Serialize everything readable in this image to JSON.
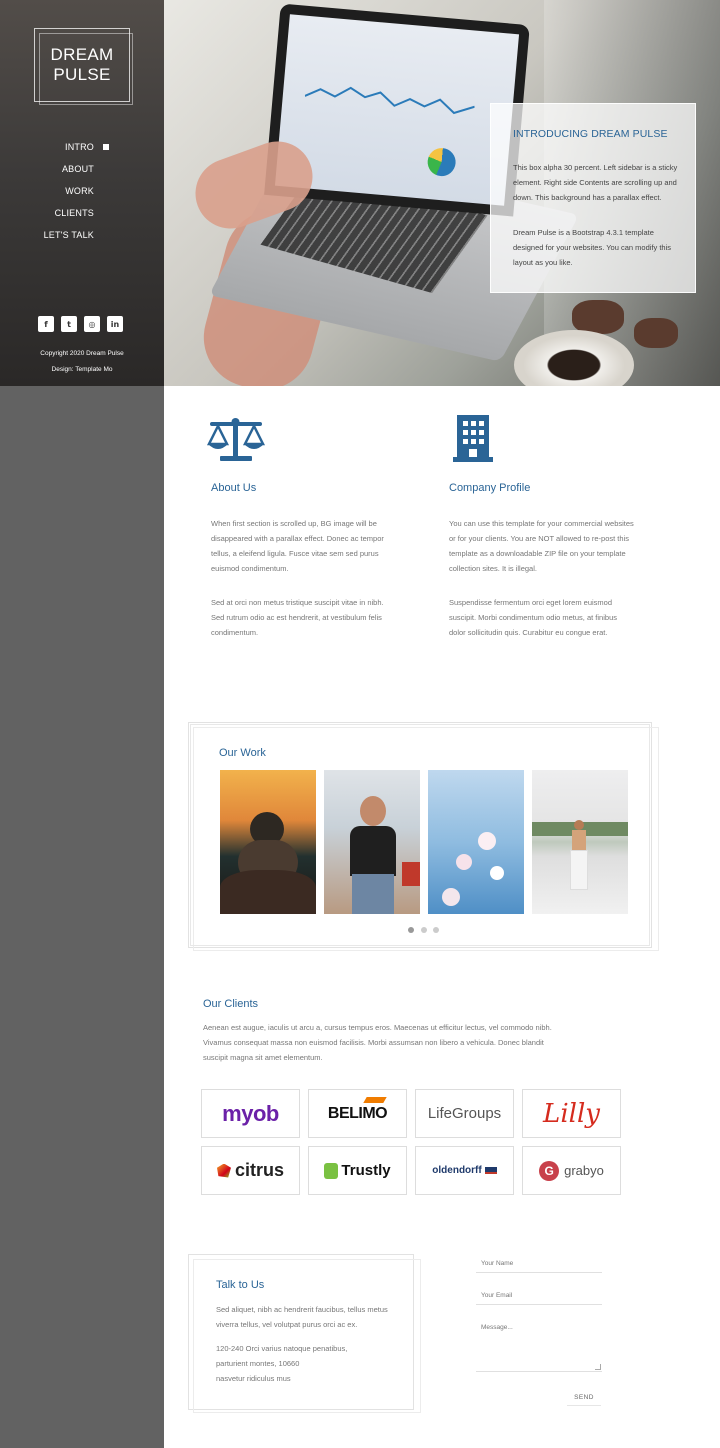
{
  "brand": {
    "line1": "DREAM",
    "line2": "PULSE"
  },
  "nav": {
    "items": [
      {
        "label": "INTRO",
        "active": true
      },
      {
        "label": "ABOUT",
        "active": false
      },
      {
        "label": "WORK",
        "active": false
      },
      {
        "label": "CLIENTS",
        "active": false
      },
      {
        "label": "LET'S TALK",
        "active": false
      }
    ]
  },
  "social": [
    {
      "icon": "facebook-icon",
      "glyph": "f"
    },
    {
      "icon": "twitter-icon",
      "glyph": "t"
    },
    {
      "icon": "dribbble-icon",
      "glyph": "◎"
    },
    {
      "icon": "linkedin-icon",
      "glyph": "in"
    }
  ],
  "footer": {
    "copyright": "Copyright 2020 Dream Pulse",
    "design": "Design: Template Mo"
  },
  "intro": {
    "title": "INTRODUCING DREAM PULSE",
    "p1": "This box alpha 30 percent. Left sidebar is a sticky element. Right side Contents are scrolling up and down. This background has a parallax effect.",
    "p2": "Dream Pulse is a Bootstrap 4.3.1 template designed for your websites. You can modify this layout as you like."
  },
  "about": {
    "title": "About Us",
    "icon": "balance-scale-icon",
    "p1": "When first section is scrolled up, BG image will be disappeared with a parallax effect. Donec ac tempor tellus, a eleifend ligula. Fusce vitae sem sed purus euismod condimentum.",
    "p2": "Sed at orci non metus tristique suscipit vitae in nibh. Sed rutrum odio ac est hendrerit, at vestibulum felis condimentum."
  },
  "company": {
    "title": "Company Profile",
    "icon": "building-icon",
    "p1": "You can use this template for your commercial websites or for your clients. You are NOT allowed to re-post this template as a downloadable ZIP file on your template collection sites. It is illegal.",
    "p2": "Suspendisse fermentum orci eget lorem euismod suscipit. Morbi condimentum odio metus, at finibus dolor sollicitudin quis. Curabitur eu congue erat."
  },
  "work": {
    "title": "Our Work",
    "photos": [
      "dog-photo",
      "woman-sunglasses-photo",
      "flowers-photo",
      "woman-rooftop-photo"
    ],
    "pages": 3,
    "active_page": 1
  },
  "clients": {
    "title": "Our Clients",
    "text": "Aenean est augue, iaculis ut arcu a, cursus tempus eros. Maecenas ut efficitur lectus, vel commodo nibh. Vivamus consequat massa non euismod facilisis. Morbi assumsan non libero a vehicula. Donec blandit suscipit magna sit amet elementum.",
    "logos": [
      {
        "name": "myob",
        "color": "#6b21a8"
      },
      {
        "name": "BELIMO",
        "color": "#111111"
      },
      {
        "name": "LifeGroups",
        "color": "#555555"
      },
      {
        "name": "Lilly",
        "color": "#d52b1e"
      },
      {
        "name": "citrus",
        "color": "#222222"
      },
      {
        "name": "Trustly",
        "color": "#111111"
      },
      {
        "name": "oldendorff",
        "color": "#1f3a6b"
      },
      {
        "name": "grabyo",
        "color": "#555555"
      }
    ]
  },
  "contact": {
    "title": "Talk to Us",
    "text": "Sed aliquet, nibh ac hendrerit faucibus, tellus metus viverra tellus, vel volutpat purus orci ac ex.",
    "address1": "120-240 Orci varius natoque penatibus,",
    "address2": "parturient montes, 10660",
    "address3": "nasvetur ridiculus mus",
    "form": {
      "name_placeholder": "Your Name",
      "email_placeholder": "Your Email",
      "message_placeholder": "Message...",
      "send_label": "SEND"
    }
  }
}
